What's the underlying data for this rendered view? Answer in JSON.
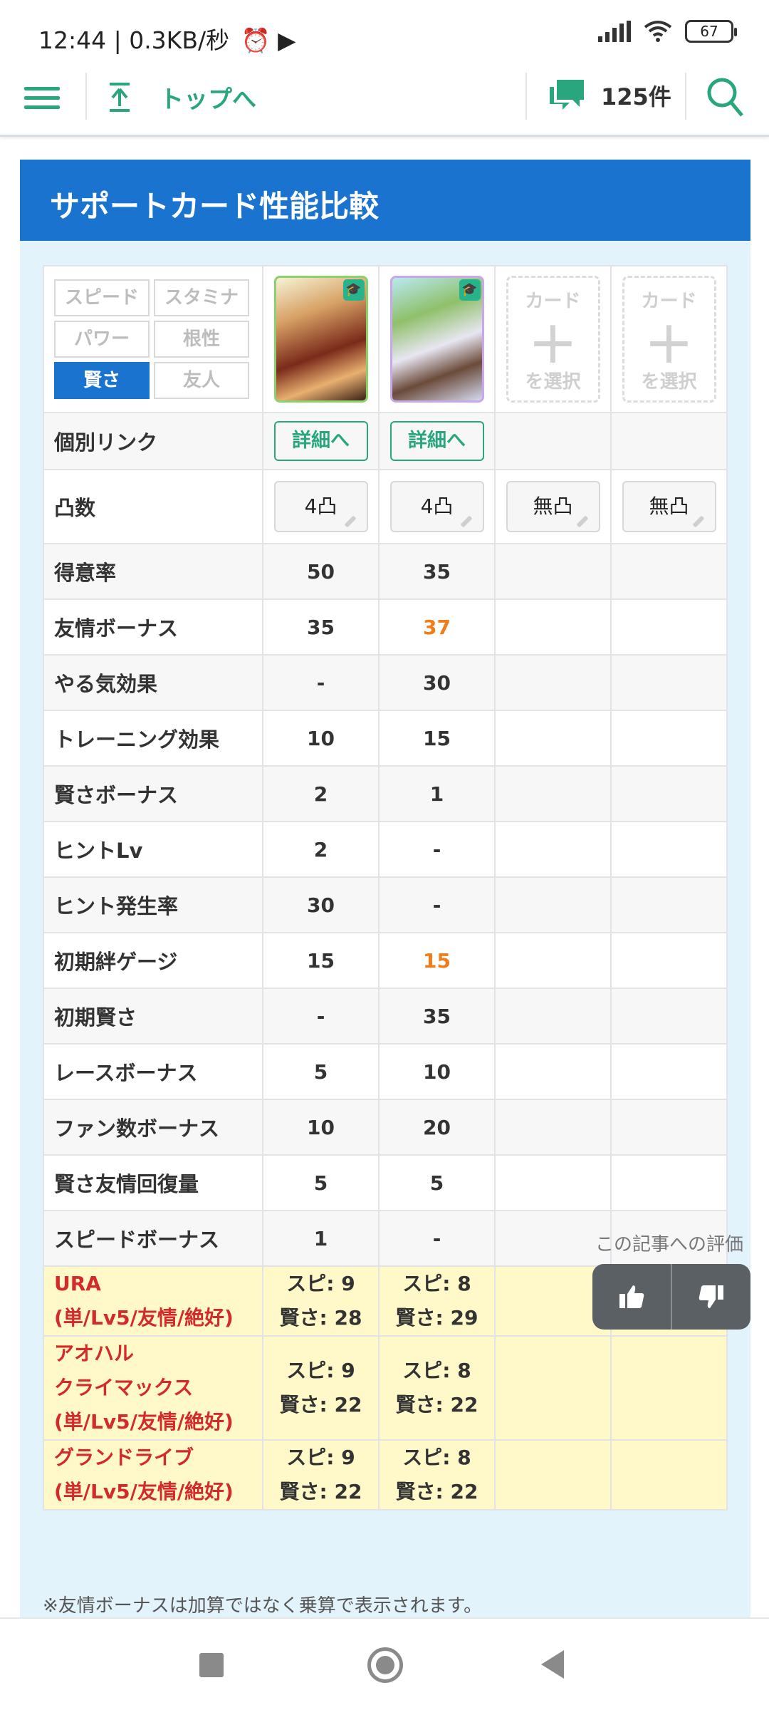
{
  "status_bar": {
    "time_text": "12:44 | 0.3KB/秒",
    "battery": "67"
  },
  "nav": {
    "top_link": "トップへ",
    "comment_count": "125件"
  },
  "panel": {
    "title": "サポートカード性能比較"
  },
  "type_buttons": [
    "スピード",
    "スタミナ",
    "パワー",
    "根性",
    "賢さ",
    "友人"
  ],
  "active_type": "賢さ",
  "card_slots": {
    "select_top": "カード",
    "select_plus": "+",
    "select_bottom": "を選択"
  },
  "links": {
    "label": "個別リンク",
    "button": "詳細へ"
  },
  "limit_break": {
    "label": "凸数",
    "values": [
      "4凸",
      "4凸",
      "無凸",
      "無凸"
    ]
  },
  "stats": [
    {
      "label": "得意率",
      "c1": "50",
      "c2": "35"
    },
    {
      "label": "友情ボーナス",
      "c1": "35",
      "c2": "37"
    },
    {
      "label": "やる気効果",
      "c1": "-",
      "c2": "30"
    },
    {
      "label": "トレーニング効果",
      "c1": "10",
      "c2": "15"
    },
    {
      "label": "賢さボーナス",
      "c1": "2",
      "c2": "1"
    },
    {
      "label": "ヒントLv",
      "c1": "2",
      "c2": "-"
    },
    {
      "label": "ヒント発生率",
      "c1": "30",
      "c2": "-"
    },
    {
      "label": "初期絆ゲージ",
      "c1": "15",
      "c2": "15"
    },
    {
      "label": "初期賢さ",
      "c1": "-",
      "c2": "35"
    },
    {
      "label": "レースボーナス",
      "c1": "5",
      "c2": "10"
    },
    {
      "label": "ファン数ボーナス",
      "c1": "10",
      "c2": "20"
    },
    {
      "label": "賢さ友情回復量",
      "c1": "5",
      "c2": "5"
    },
    {
      "label": "スピードボーナス",
      "c1": "1",
      "c2": "-"
    }
  ],
  "scenarios": [
    {
      "name_lines": [
        "URA",
        "(単/Lv5/友情/絶好)"
      ],
      "c1": [
        "スピ: 9",
        "賢さ: 28"
      ],
      "c2": [
        "スピ: 8",
        "賢さ: 29"
      ]
    },
    {
      "name_lines": [
        "アオハル",
        "クライマックス",
        "(単/Lv5/友情/絶好)"
      ],
      "c1": [
        "スピ: 9",
        "賢さ: 22"
      ],
      "c2": [
        "スピ: 8",
        "賢さ: 22"
      ]
    },
    {
      "name_lines": [
        "グランドライブ",
        "(単/Lv5/友情/絶好)"
      ],
      "c1": [
        "スピ: 9",
        "賢さ: 22"
      ],
      "c2": [
        "スピ: 8",
        "賢さ: 22"
      ]
    }
  ],
  "note": "※友情ボーナスは加算ではなく乗算で表示されます。",
  "rating": {
    "title": "この記事への評価"
  },
  "colors": {
    "brand_blue": "#1a73cf",
    "accent_green": "#2aa67f",
    "highlight_orange": "#f07c1a",
    "scenario_red": "#d32b2b",
    "scenario_bg": "#fff8c8"
  }
}
